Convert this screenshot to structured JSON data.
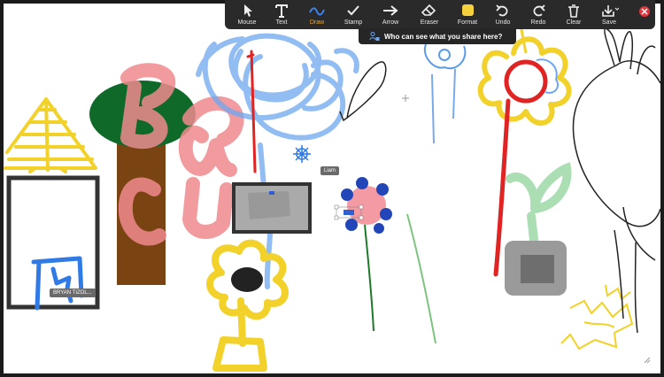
{
  "toolbar": {
    "tools": [
      {
        "id": "mouse",
        "label": "Mouse",
        "icon": "cursor-arrow-icon"
      },
      {
        "id": "text",
        "label": "Text",
        "icon": "text-t-icon"
      },
      {
        "id": "draw",
        "label": "Draw",
        "icon": "squiggle-draw-icon",
        "active": true
      },
      {
        "id": "stamp",
        "label": "Stamp",
        "icon": "checkmark-stamp-icon"
      },
      {
        "id": "arrow",
        "label": "Arrow",
        "icon": "arrow-right-icon"
      },
      {
        "id": "eraser",
        "label": "Eraser",
        "icon": "eraser-icon"
      },
      {
        "id": "format",
        "label": "Format",
        "icon": "format-swatch-icon"
      },
      {
        "id": "undo",
        "label": "Undo",
        "icon": "undo-icon"
      },
      {
        "id": "redo",
        "label": "Redo",
        "icon": "redo-icon"
      },
      {
        "id": "clear",
        "label": "Clear",
        "icon": "trash-icon"
      },
      {
        "id": "save",
        "label": "Save",
        "icon": "download-save-icon"
      }
    ],
    "active_color": "#f0a72a",
    "format_swatch_color": "#f5d23c",
    "close_color": "#e0353b"
  },
  "share_banner": {
    "text": "Who can see what you share here?",
    "icon": "people-lock-icon"
  },
  "annotators": [
    {
      "name": "Liam"
    },
    {
      "name": "BRYAN TIZOL..."
    }
  ],
  "colors": {
    "canvas": "#ffffff",
    "frame": "#1b1b1b",
    "toolbar": "#2a2a2a"
  }
}
